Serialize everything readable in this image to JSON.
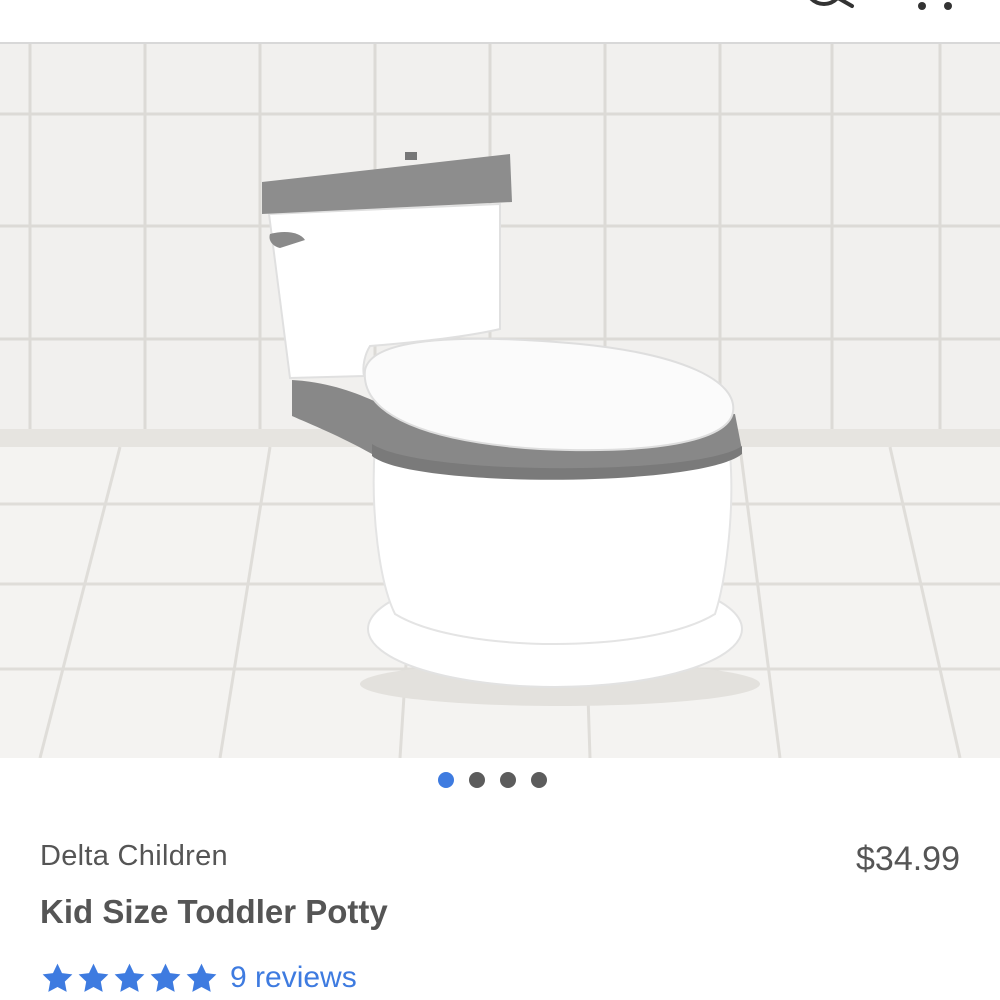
{
  "header": {
    "menu_icon": "hamburger-menu-icon",
    "search_icon": "search-icon",
    "more_icon": "more-options-icon"
  },
  "gallery": {
    "image_alt": "Kid Size Toddler Potty",
    "dots": [
      {
        "active": true,
        "color": "#3e7be0"
      },
      {
        "active": false,
        "color": "#5c5c5c"
      },
      {
        "active": false,
        "color": "#5c5c5c"
      },
      {
        "active": false,
        "color": "#5c5c5c"
      }
    ]
  },
  "product": {
    "brand": "Delta Children",
    "name": "Kid Size Toddler Potty",
    "price": "$34.99",
    "rating": 5,
    "rating_max": 5,
    "reviews_label": "9 reviews",
    "accent_color": "#3e7be0"
  }
}
